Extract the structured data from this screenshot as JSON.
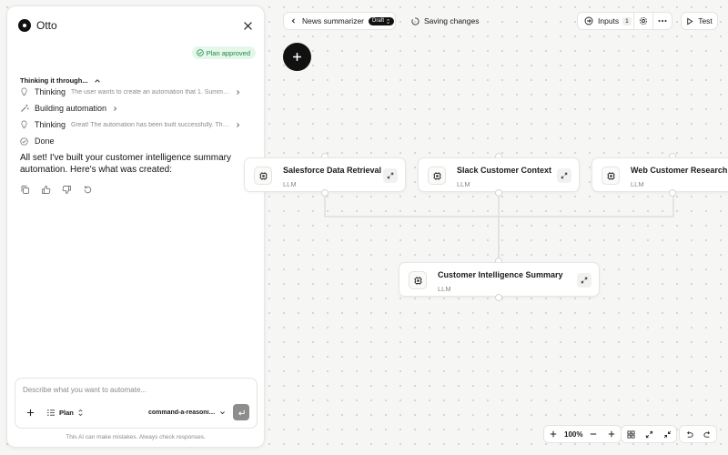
{
  "panel": {
    "title": "Otto",
    "plan_badge": "Plan approved",
    "thinking_header": "Thinking it through...",
    "steps": [
      {
        "label": "Thinking",
        "desc": "The user wants to create an automation that 1. Summarize..."
      },
      {
        "label": "Building automation",
        "desc": ""
      },
      {
        "label": "Thinking",
        "desc": "Great! The automation has been built successfully. The bui..."
      },
      {
        "label": "Done",
        "desc": ""
      }
    ],
    "message": "All set! I've built your customer intelligence summary automation. Here's what was created:",
    "composer": {
      "placeholder": "Describe what you want to automate...",
      "plan_label": "Plan",
      "model_name": "command-a-reasoning"
    },
    "disclaimer": "This AI can make mistakes. Always check responses."
  },
  "toolbar": {
    "workflow_name": "News summarizer",
    "draft_label": "Draft",
    "status": "Saving changes",
    "inputs_label": "Inputs",
    "inputs_count": "1",
    "test_label": "Test"
  },
  "nodes": [
    {
      "title": "Salesforce Data Retrieval",
      "type": "LLM"
    },
    {
      "title": "Slack Customer Context",
      "type": "LLM"
    },
    {
      "title": "Web Customer Research",
      "type": "LLM"
    },
    {
      "title": "Customer Intelligence Summary",
      "type": "LLM"
    }
  ],
  "zoom": "100%",
  "colors": {
    "accent": "#111111",
    "approved_bg": "#e5f6ea",
    "approved_text": "#1d8a45",
    "canvas_bg": "#f6f6f5"
  }
}
